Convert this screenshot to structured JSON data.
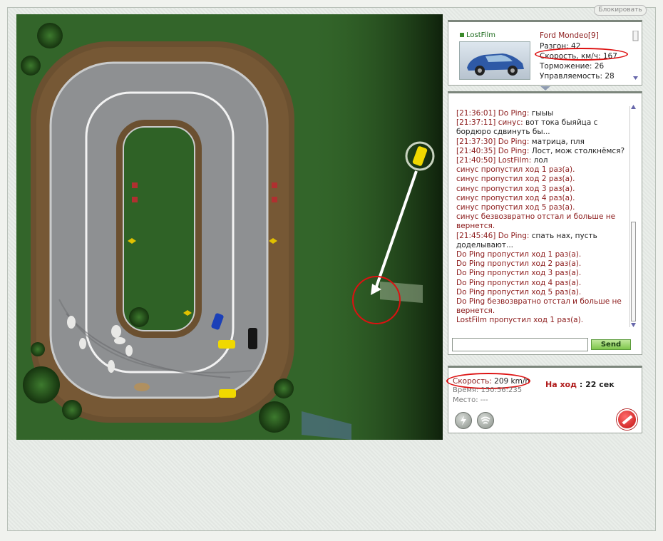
{
  "header": {
    "block_label": "Блокировать"
  },
  "player": {
    "name": "LostFilm",
    "car_model": "Ford Mondeo[9]",
    "stats": [
      {
        "label": "Разгон",
        "value": "42"
      },
      {
        "label": "Скорость, км/ч",
        "value": "167"
      },
      {
        "label": "Торможение",
        "value": "26"
      },
      {
        "label": "Управляемость",
        "value": "28"
      }
    ]
  },
  "chat": {
    "lines": [
      {
        "ts": "[21:36:01]",
        "nick": "Do Ping:",
        "msg": " гыыы"
      },
      {
        "ts": "[21:37:11]",
        "nick": "синус:",
        "msg": " вот тока быяйца с бордюро сдвинуть бы..."
      },
      {
        "ts": "[21:37:30]",
        "nick": "Do Ping:",
        "msg": " матрица, пля"
      },
      {
        "ts": "[21:40:35]",
        "nick": "Do Ping:",
        "msg": " Лост, мож столкнёмся?"
      },
      {
        "ts": "[21:40:50]",
        "nick": "LostFilm:",
        "msg": " лол"
      },
      {
        "sys": "синус пропустил ход 1 раз(а)."
      },
      {
        "sys": "синус пропустил ход 2 раз(а)."
      },
      {
        "sys": "синус пропустил ход 3 раз(а)."
      },
      {
        "sys": "синус пропустил ход 4 раз(а)."
      },
      {
        "sys": "синус пропустил ход 5 раз(а)."
      },
      {
        "sys": "синус безвозвратно отстал и больше не вернется."
      },
      {
        "ts": "[21:45:46]",
        "nick": "Do Ping:",
        "msg": " спать нах, пусть доделывают..."
      },
      {
        "sys": "Do Ping пропустил ход 1 раз(а)."
      },
      {
        "sys": "Do Ping пропустил ход 2 раз(а)."
      },
      {
        "sys": "Do Ping пропустил ход 3 раз(а)."
      },
      {
        "sys": "Do Ping пропустил ход 4 раз(а)."
      },
      {
        "sys": "Do Ping пропустил ход 5 раз(а)."
      },
      {
        "sys": "Do Ping безвозвратно отстал и больше не вернется."
      },
      {
        "sys": "LostFilm пропустил ход 1 раз(а)."
      }
    ],
    "input_value": "",
    "send_label": "Send"
  },
  "status": {
    "speed_label": "Скорость:",
    "speed_value": "209 km/h",
    "time_label": "Время:",
    "time_value": "150:56:235",
    "place_label": "Место:",
    "place_value": "---",
    "turn_label": "На ход",
    "turn_sep": ":",
    "turn_value": "22 сек"
  },
  "colors": {
    "accent_red": "#b01b1b",
    "send_green": "#7fc64c",
    "grass": "#2c5a22",
    "track": "#8a8c8e"
  }
}
